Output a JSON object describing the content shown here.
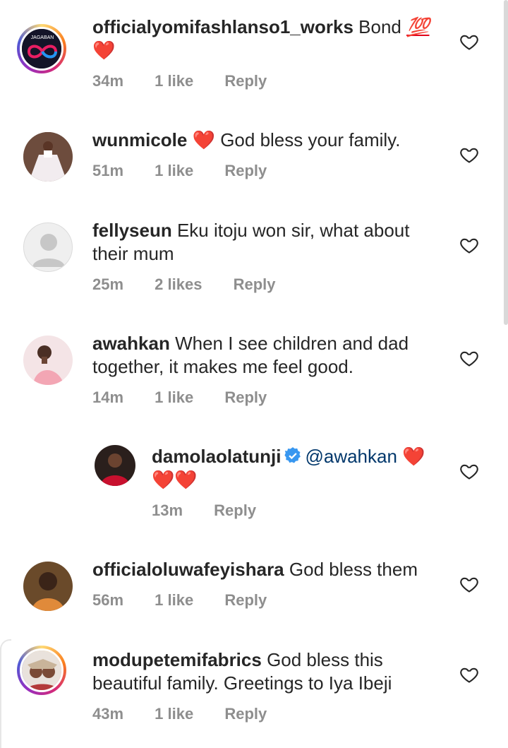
{
  "comments": [
    {
      "user": "officialyomifashlanso1_works",
      "text": "Bond",
      "emoji": "💯",
      "extra": "❤️",
      "time": "34m",
      "likes": "1 like",
      "reply": "Reply",
      "avatar_label": "JAGABAN"
    },
    {
      "user": "wunmicole",
      "pre": "❤️",
      "text": "God bless your family.",
      "time": "51m",
      "likes": "1 like",
      "reply": "Reply"
    },
    {
      "user": "fellyseun",
      "text": "Eku itoju won sir,  what about",
      "text2": "their mum",
      "time": "25m",
      "likes": "2 likes",
      "reply": "Reply"
    },
    {
      "user": "awahkan",
      "text": "When I see children and dad",
      "text2": "together, it makes me feel good.",
      "time": "14m",
      "likes": "1 like",
      "reply": "Reply"
    },
    {
      "user": "damolaolatunji",
      "mention": "@awahkan",
      "hearts": "❤️",
      "hearts2": "❤️❤️",
      "time": "13m",
      "reply": "Reply"
    },
    {
      "user": "officialoluwafeyishara",
      "text": "God bless them",
      "time": "56m",
      "likes": "1 like",
      "reply": "Reply"
    },
    {
      "user": "modupetemifabrics",
      "text": "God bless this",
      "text2": "beautiful family. Greetings to Iya Ibeji",
      "time": "43m",
      "likes": "1 like",
      "reply": "Reply"
    }
  ],
  "colors": {
    "heart_red": "#e2001a",
    "meta_gray": "#8e8e8e",
    "verified_blue": "#3897f0",
    "mention_blue": "#00376b"
  }
}
